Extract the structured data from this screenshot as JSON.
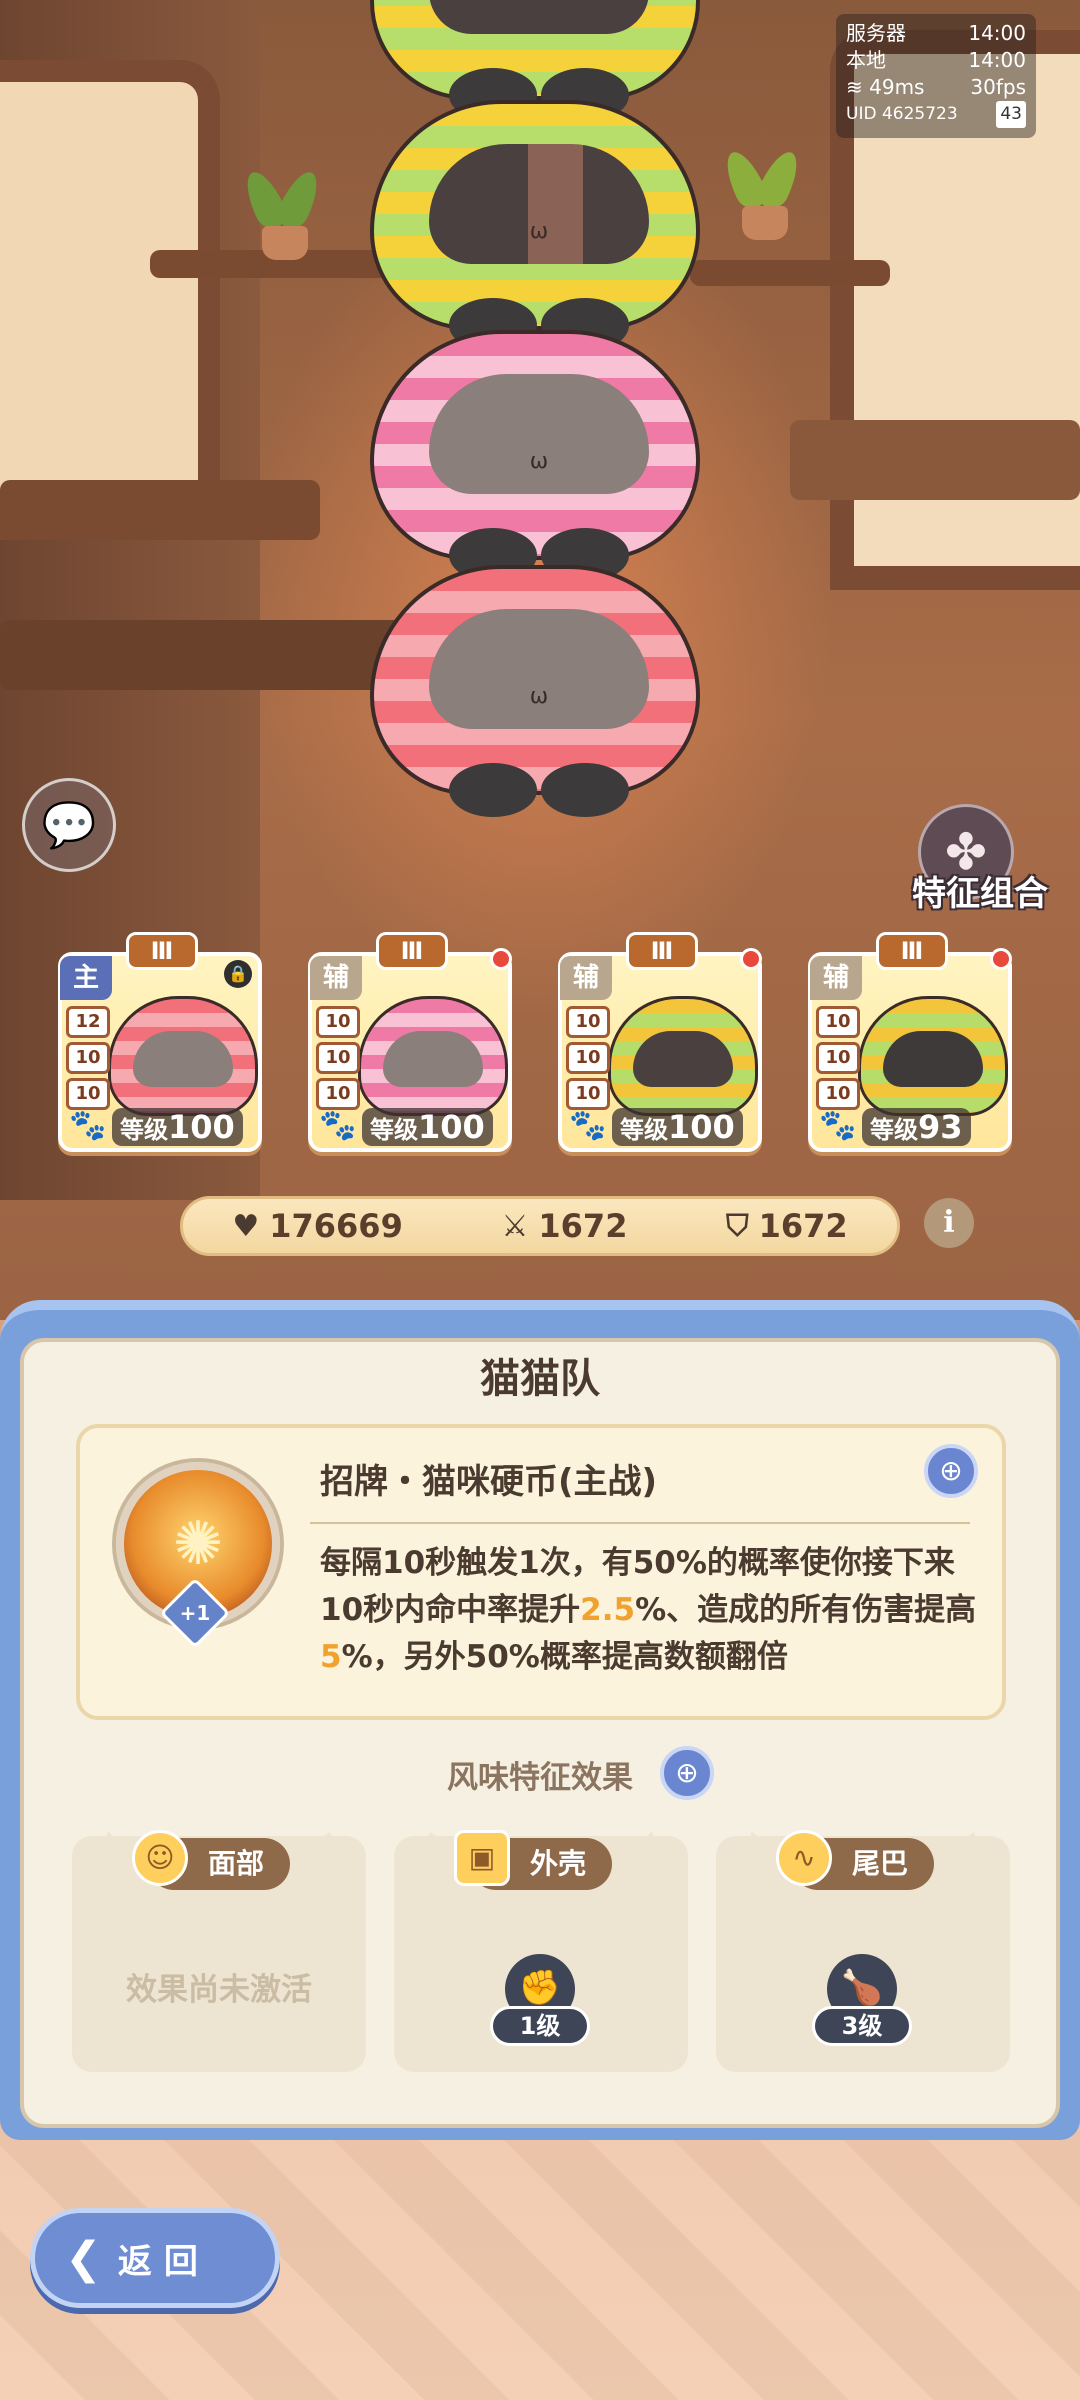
{
  "hud": {
    "server_label": "服务器",
    "server_time": "14:00",
    "local_label": "本地",
    "local_time": "14:00",
    "ping": "49ms",
    "fps": "30fps",
    "uid": "UID 4625723",
    "battery": "43"
  },
  "trait_combo": {
    "label": "特征组合",
    "icon": "clover-icon"
  },
  "team": [
    {
      "tier": "Ⅲ",
      "role": "主",
      "stats": [
        "12",
        "10",
        "10"
      ],
      "level_label": "等级",
      "level": "100",
      "colors": [
        "#f2707a",
        "#f7a9b0"
      ],
      "status": "lock"
    },
    {
      "tier": "Ⅲ",
      "role": "辅",
      "stats": [
        "10",
        "10",
        "10"
      ],
      "level_label": "等级",
      "level": "100",
      "colors": [
        "#f07aa6",
        "#f9c1d4"
      ],
      "status": "dot"
    },
    {
      "tier": "Ⅲ",
      "role": "辅",
      "stats": [
        "10",
        "10",
        "10"
      ],
      "level_label": "等级",
      "level": "100",
      "colors": [
        "#f2c53a",
        "#b6dd6a"
      ],
      "status": "dot"
    },
    {
      "tier": "Ⅲ",
      "role": "辅",
      "stats": [
        "10",
        "10",
        "10"
      ],
      "level_label": "等级",
      "level": "93",
      "colors": [
        "#f2c53a",
        "#b6dd6a"
      ],
      "status": "dot"
    }
  ],
  "stats": {
    "hp": "176669",
    "attack": "1672",
    "defense": "1672"
  },
  "panel": {
    "title": "猫猫队",
    "skill_name": "招牌・猫咪硬币(主战)",
    "skill_plus": "+1",
    "skill_desc_parts": {
      "p1": "每隔10秒触发1次，有50%的概率使你接下来10秒内命中率提升",
      "h1": "2.5",
      "p2": "%、造成的所有伤害提高",
      "h2": "5",
      "p3": "%，另外50%概率提高数额翻倍"
    },
    "flavor_title": "风味特征效果",
    "flavors": [
      {
        "name": "面部",
        "icon": "face-icon",
        "inactive_text": "效果尚未激活"
      },
      {
        "name": "外壳",
        "icon": "shell-icon",
        "badge_icon": "fist-icon",
        "level": "1级"
      },
      {
        "name": "尾巴",
        "icon": "tail-icon",
        "badge_icon": "drumstick-icon",
        "level": "3级"
      }
    ]
  },
  "back_button": {
    "label": "返回"
  },
  "colors": {
    "panel_blue": "#7aa0dc",
    "highlight": "#f0a22c",
    "tag_brown": "#8e6a4b"
  }
}
